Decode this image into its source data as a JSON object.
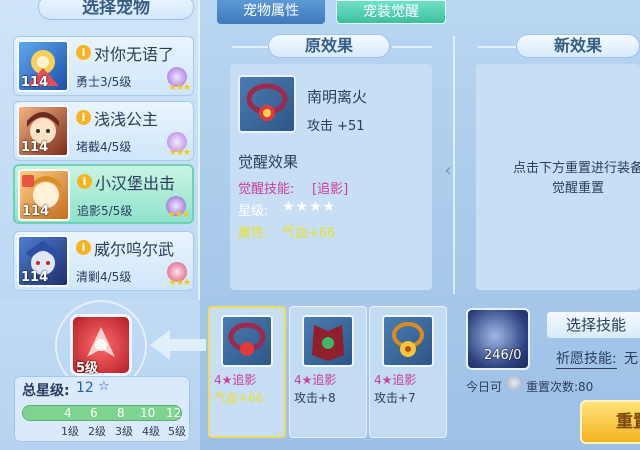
{
  "left": {
    "title": "选择宠物",
    "pets": [
      {
        "name": "对你无语了",
        "level": "114",
        "skill": "勇士3/5级",
        "info": "i",
        "stars": "★★★"
      },
      {
        "name": "浅浅公主",
        "level": "114",
        "skill": "堵截4/5级",
        "info": "i",
        "stars": "★★★"
      },
      {
        "name": "小汉堡出击",
        "level": "114",
        "skill": "追影5/5级",
        "info": "i",
        "stars": "★★★",
        "selected": true
      },
      {
        "name": "威尔呜尔武",
        "level": "114",
        "skill": "清剿4/5级",
        "info": "i",
        "stars": "★★★"
      }
    ]
  },
  "tabs": {
    "pet_attr": "宠物属性",
    "equip_awaken": "宠装觉醒"
  },
  "original": {
    "header": "原效果",
    "item_name": "南明离火",
    "item_attack": "攻击 +51",
    "awaken_title": "觉醒效果",
    "skill_label": "觉醒技能:",
    "skill_value": "[追影]",
    "star_label": "星级:",
    "star_value": "★★★★",
    "attr_label": "属性:",
    "attr_value": "气血+66"
  },
  "new_effect": {
    "header": "新效果",
    "hint": "点击下方重置进行装备觉醒重置"
  },
  "bottom_left": {
    "slot_level": "5级",
    "total_label": "总星级:",
    "total_value": "12",
    "total_star": "☆",
    "progress_fraction": 1.0,
    "ticks": [
      "4",
      "6",
      "8",
      "10",
      "12"
    ],
    "levels": [
      "1级",
      "2级",
      "3级",
      "4级",
      "5级"
    ]
  },
  "equipment": [
    {
      "skill": "4★追影",
      "attr": "气血+66",
      "attr_color": "#e8e02a",
      "selected": true
    },
    {
      "skill": "4★追影",
      "attr": "攻击+8",
      "attr_color": "#2a3d5c"
    },
    {
      "skill": "4★追影",
      "attr": "攻击+7",
      "attr_color": "#2a3d5c"
    }
  ],
  "right_bottom": {
    "orb_count": "246/0",
    "select_skill": "选择技能",
    "wish_label": "祈愿技能:",
    "wish_value": "无",
    "today_label": "今日可",
    "reset_count": "重置次数:80",
    "reset_button": "重置"
  }
}
